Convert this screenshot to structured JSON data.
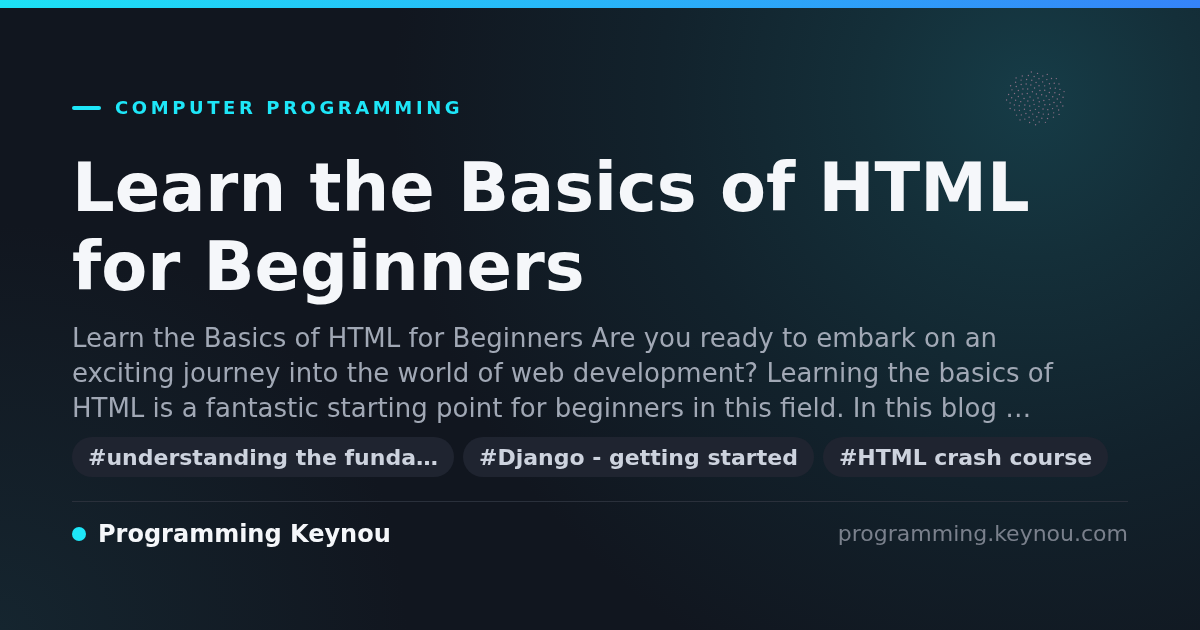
{
  "category": "COMPUTER PROGRAMMING",
  "title": "Learn the Basics of HTML for Beginners",
  "description": "Learn the Basics of HTML for Beginners Are you ready to embark on an exciting journey into the world of web development? Learning the basics of HTML is a fantastic starting point for beginners in this field. In this blog …",
  "tags": [
    "#understanding the funda…",
    "#Django - getting started",
    "#HTML crash course"
  ],
  "footer": {
    "site_name": "Programming Keynou",
    "url": "programming.keynou.com"
  }
}
